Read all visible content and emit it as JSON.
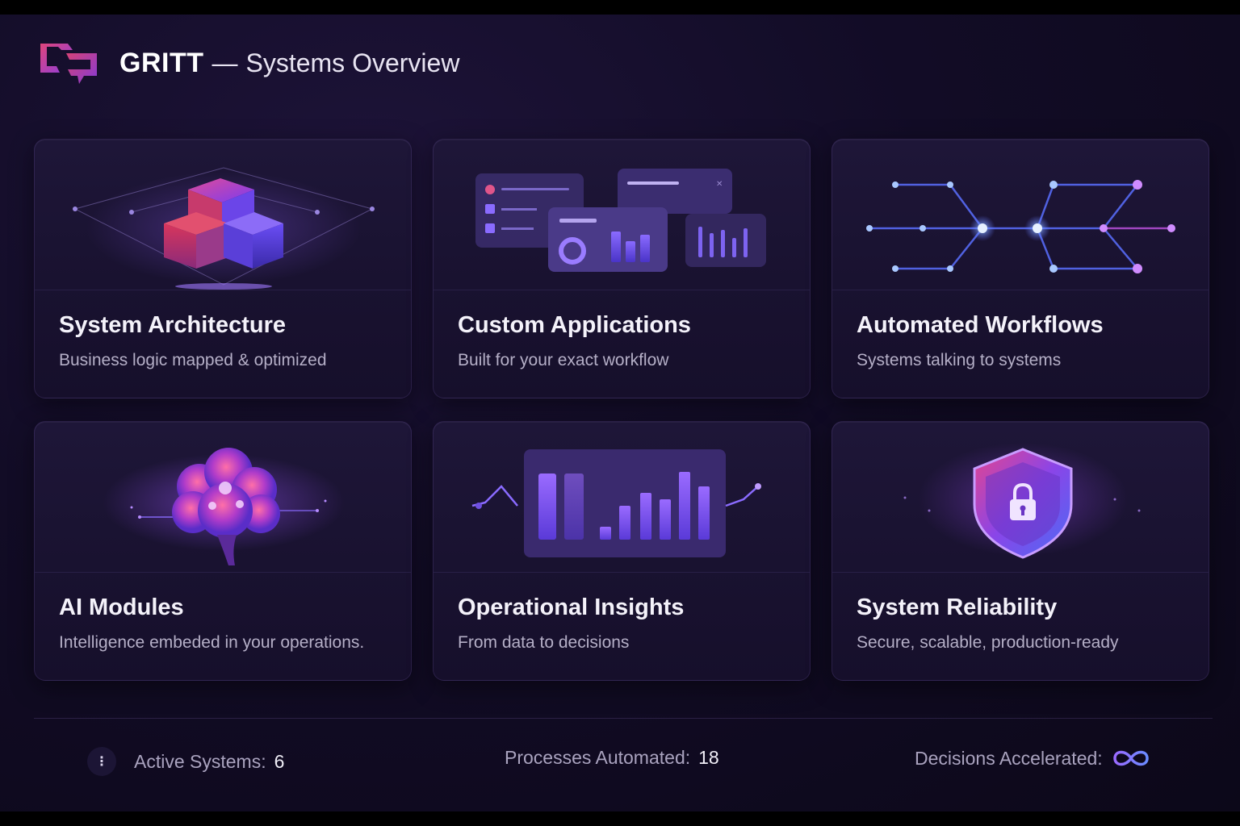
{
  "header": {
    "brand": "GRITT",
    "separator": "—",
    "subtitle": "Systems Overview",
    "logo_icon": "gritt-logo-icon"
  },
  "cards": [
    {
      "title": "System Architecture",
      "desc": "Business logic mapped & optimized",
      "icon": "cubes-icon"
    },
    {
      "title": "Custom Applications",
      "desc": "Built for your exact workflow",
      "icon": "app-windows-icon"
    },
    {
      "title": "Automated Workflows",
      "desc": "Systems talking to systems",
      "icon": "node-graph-icon"
    },
    {
      "title": "AI Modules",
      "desc": "Intelligence embeded in your operations.",
      "icon": "brain-icon"
    },
    {
      "title": "Operational Insights",
      "desc": "From data to decisions",
      "icon": "bar-chart-icon"
    },
    {
      "title": "System Reliability",
      "desc": "Secure, scalable, production-ready",
      "icon": "shield-lock-icon"
    }
  ],
  "footer": {
    "active_label": "Active Systems:",
    "active_value": "6",
    "processes_label": "Processes Automated:",
    "processes_value": "18",
    "decisions_label": "Decisions Accelerated:",
    "decisions_icon": "infinity-icon",
    "menu_icon": "vertical-dots-icon"
  },
  "colors": {
    "background": "#120c26",
    "card": "#1c1435",
    "accent_purple": "#7b4dff",
    "accent_magenta": "#d63b9a",
    "accent_blue": "#4f8dff"
  }
}
